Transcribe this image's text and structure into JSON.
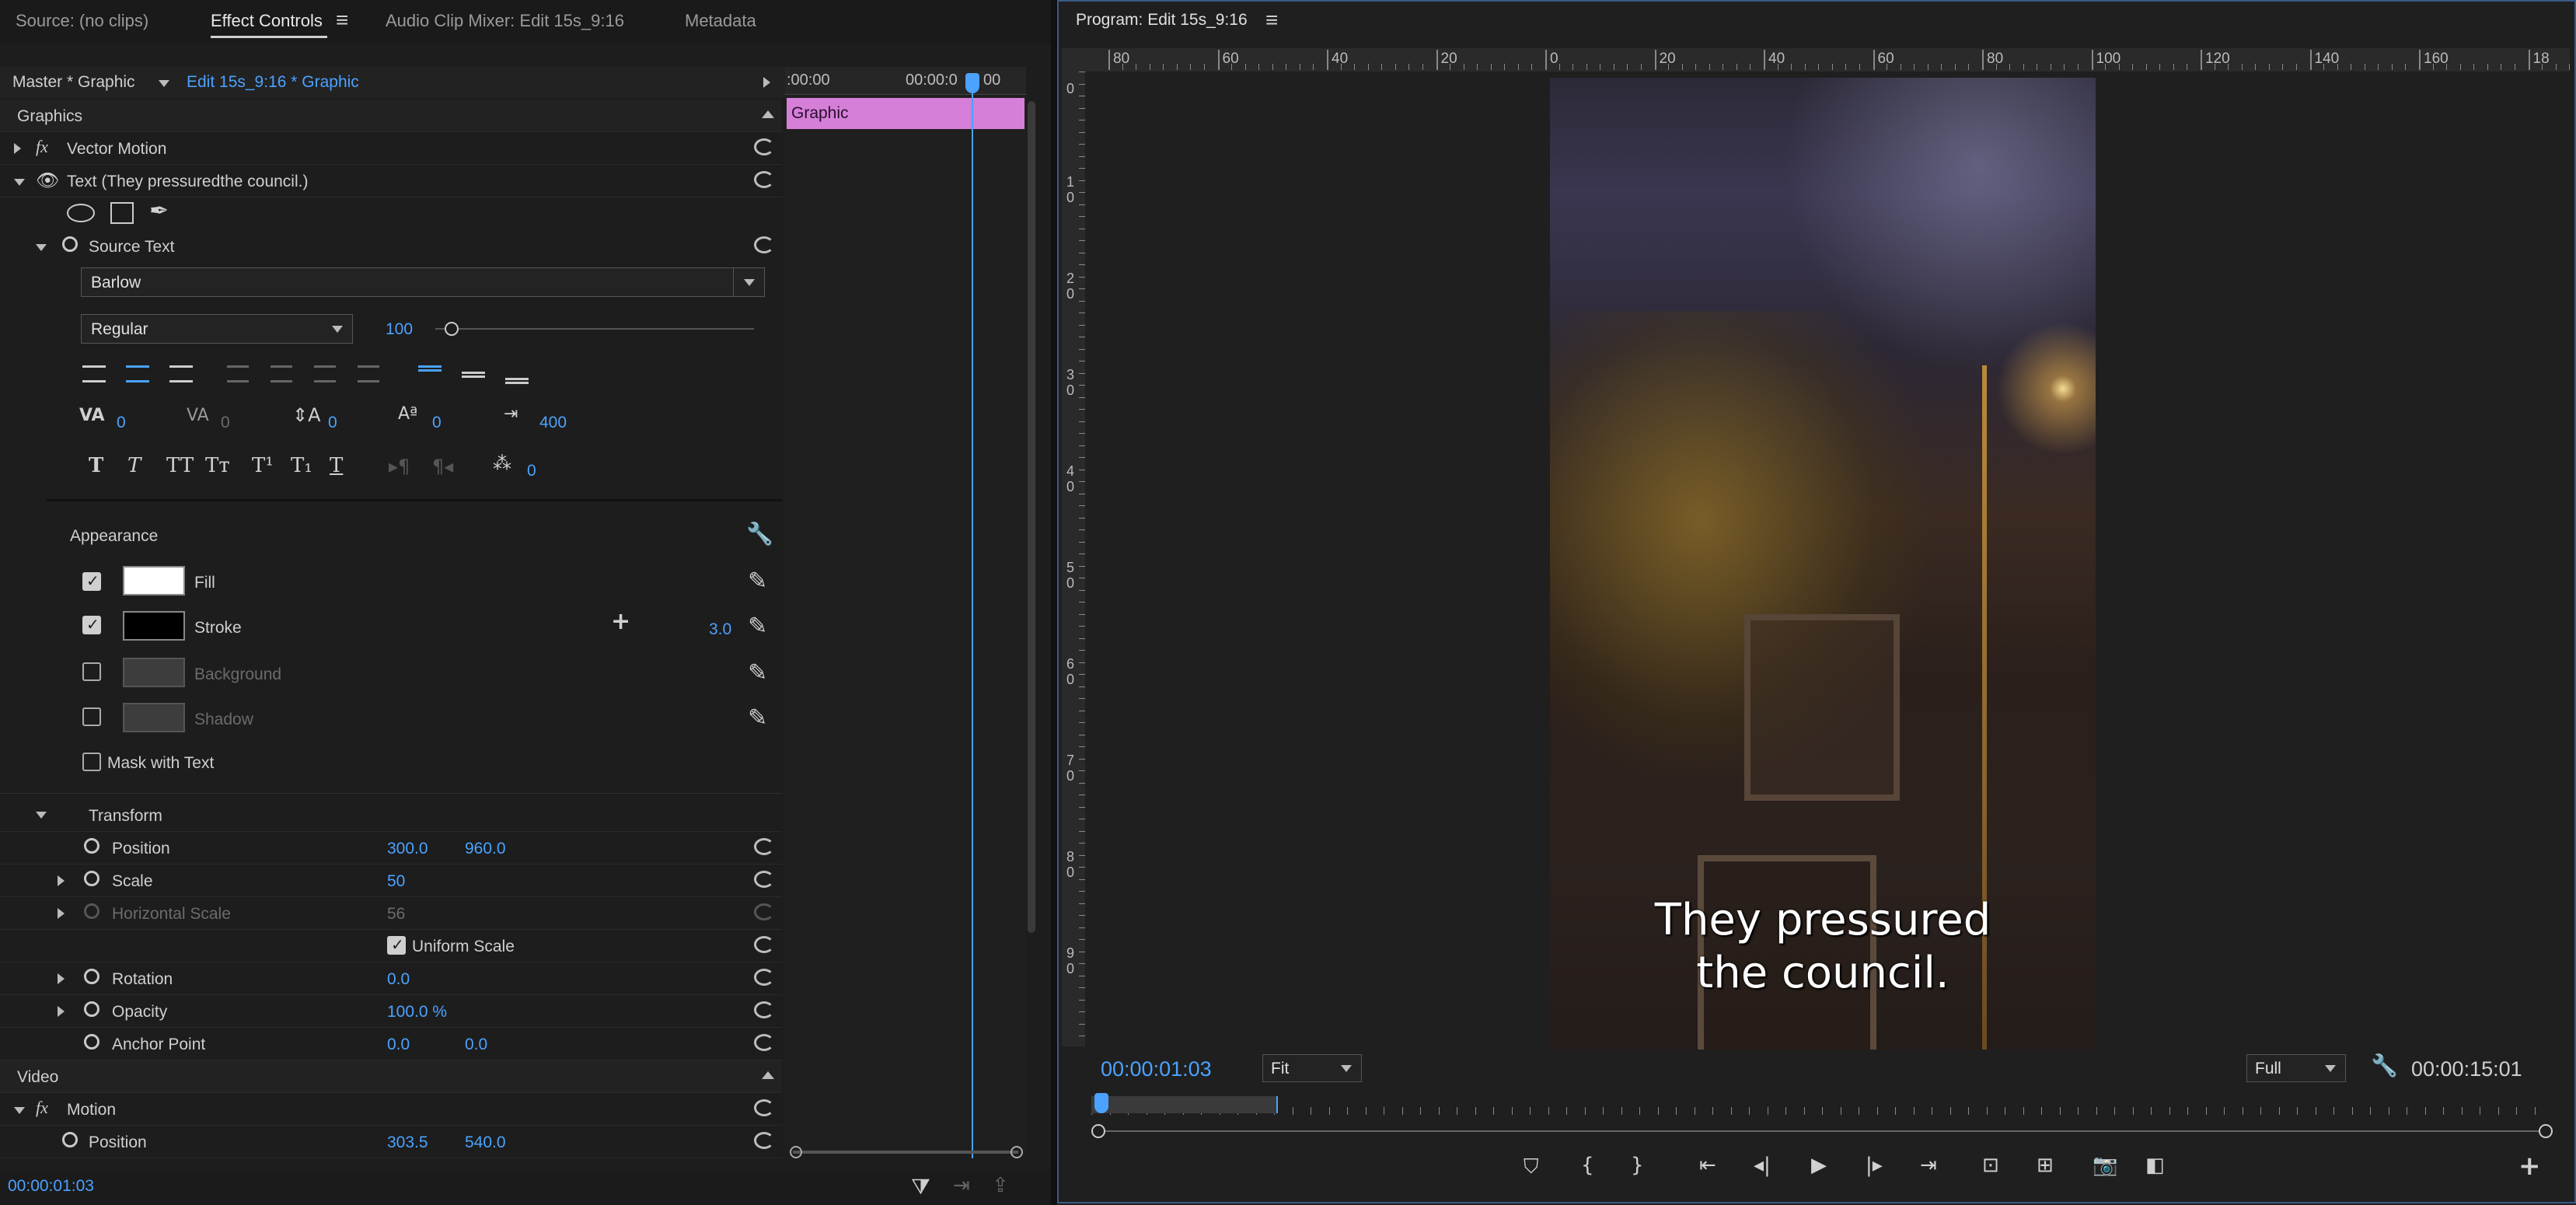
{
  "tabs": {
    "source": "Source: (no clips)",
    "effect_controls": "Effect Controls",
    "audio_mixer": "Audio Clip Mixer: Edit 15s_9:16",
    "metadata": "Metadata",
    "menu": "≡"
  },
  "clip_header": {
    "master": "Master * Graphic",
    "sequence": "Edit 15s_9:16 * Graphic",
    "tc_start": ":00:00",
    "tc_mid": "00:00:0",
    "tc_mid2": "00",
    "clip_label": "Graphic"
  },
  "sections": {
    "graphics": "Graphics",
    "vector_motion": "Vector Motion",
    "fx": "fx",
    "text_layer": "Text (They pressuredthe council.)",
    "source_text": "Source Text",
    "appearance": "Appearance",
    "transform": "Transform",
    "video": "Video",
    "motion": "Motion"
  },
  "text_props": {
    "font": "Barlow",
    "style": "Regular",
    "size": "100",
    "size_fraction": 0.06,
    "kerning": "0",
    "tracking": "0",
    "leading": "0",
    "baseline": "0",
    "tab_width": "400",
    "tsume": "0"
  },
  "appearance": {
    "fill": "Fill",
    "fill_color": "#ffffff",
    "stroke": "Stroke",
    "stroke_color": "#000000",
    "stroke_width": "3.0",
    "background": "Background",
    "shadow": "Shadow",
    "mask_with_text": "Mask with Text"
  },
  "transform": {
    "position_label": "Position",
    "position_x": "300.0",
    "position_y": "960.0",
    "scale_label": "Scale",
    "scale": "50",
    "hscale_label": "Horizontal Scale",
    "hscale": "56",
    "uniform_label": "Uniform Scale",
    "rotation_label": "Rotation",
    "rotation": "0.0",
    "opacity_label": "Opacity",
    "opacity": "100.0 %",
    "anchor_label": "Anchor Point",
    "anchor_x": "0.0",
    "anchor_y": "0.0"
  },
  "motion": {
    "position_label": "Position",
    "position_x": "303.5",
    "position_y": "540.0"
  },
  "footer": {
    "timecode": "00:00:01:03"
  },
  "program": {
    "title": "Program: Edit 15s_9:16",
    "menu": "≡",
    "ruler_h": [
      "80",
      "60",
      "40",
      "20",
      "0",
      "20",
      "40",
      "60",
      "80",
      "100",
      "120",
      "140",
      "160",
      "18"
    ],
    "ruler_v": [
      "0",
      "1",
      "0",
      "2",
      "0",
      "3",
      "0",
      "4",
      "0",
      "5",
      "0",
      "6",
      "0",
      "7",
      "0",
      "8",
      "0",
      "9",
      "0"
    ],
    "caption_line1": "They pressured",
    "caption_line2": "the council.",
    "timecode": "00:00:01:03",
    "fit": "Fit",
    "quality": "Full",
    "duration": "00:00:15:01",
    "playhead_position": 0.003
  },
  "colors": {
    "accent": "#4ba2ff",
    "clip": "#d57fd9",
    "panel_border": "#3b5a86"
  }
}
